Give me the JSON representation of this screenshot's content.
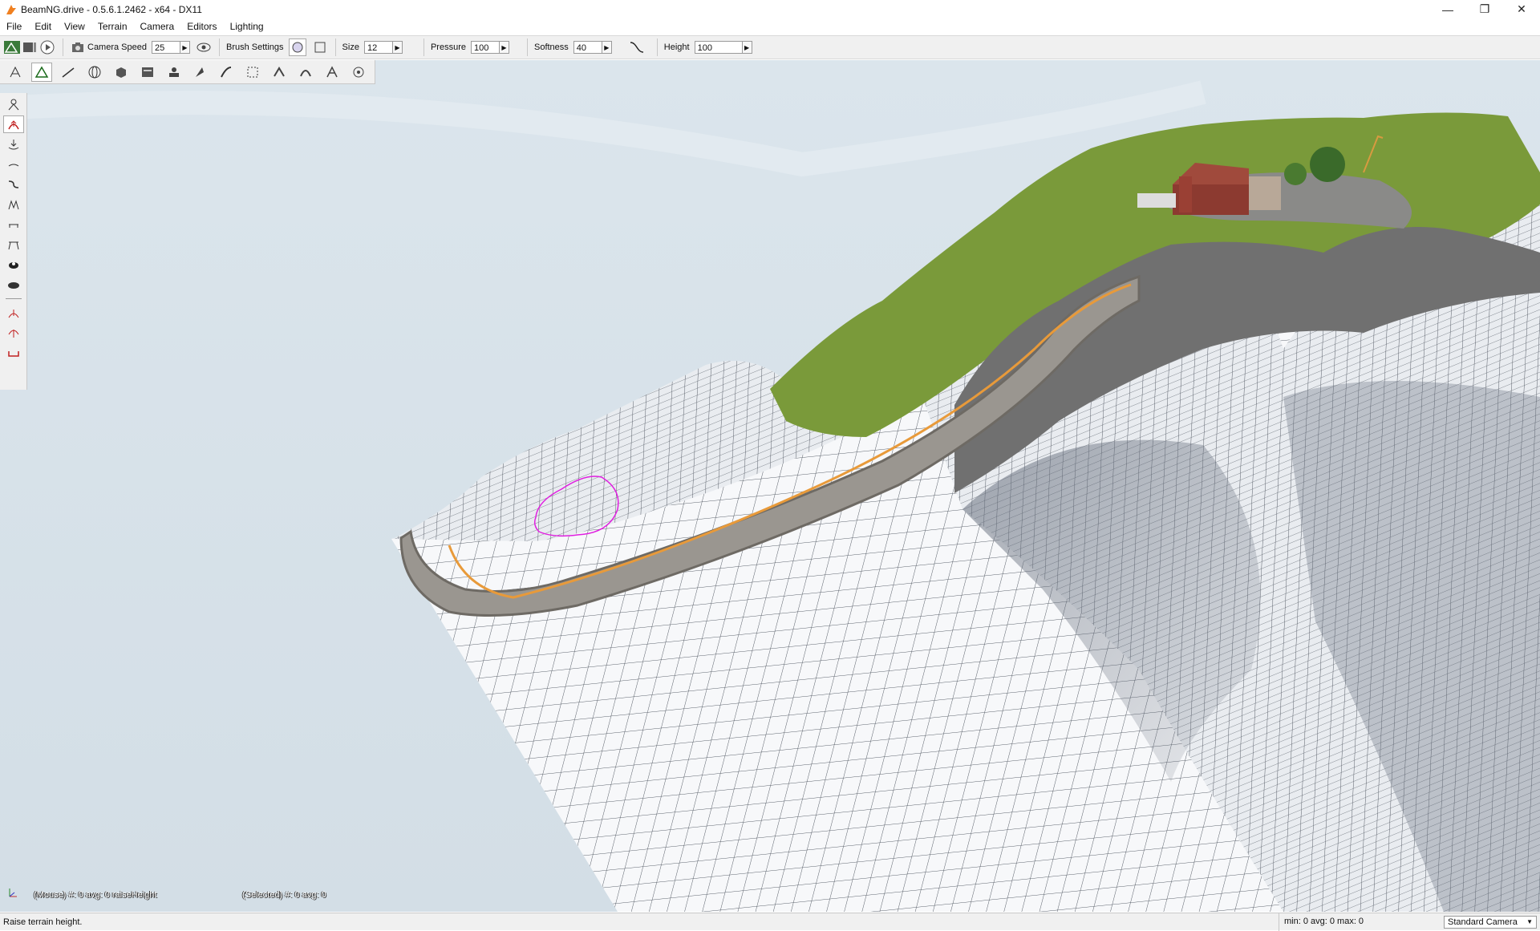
{
  "window": {
    "title": "BeamNG.drive - 0.5.6.1.2462 - x64 - DX11",
    "controls": [
      "minimize-icon",
      "restore-icon",
      "close-icon"
    ]
  },
  "menu": [
    "File",
    "Edit",
    "View",
    "Terrain",
    "Camera",
    "Editors",
    "Lighting"
  ],
  "toolbar": {
    "camera_speed_label": "Camera Speed",
    "camera_speed_value": "25",
    "brush_settings_label": "Brush Settings",
    "size_label": "Size",
    "size_value": "12",
    "pressure_label": "Pressure",
    "pressure_value": "100",
    "softness_label": "Softness",
    "softness_value": "40",
    "height_label": "Height",
    "height_value": "100"
  },
  "viewport": {
    "mouse_info": "(Mouse) #: 0  avg: 0 raiseHeight",
    "selected_info": "(Selected) #: 0  avg: 0"
  },
  "status": {
    "message": "Raise terrain height.",
    "stats": "min: 0  avg: 0  max: 0",
    "camera_mode": "Standard Camera"
  },
  "colors": {
    "brush_outline": "#e020e0",
    "road_line": "#e89a3a",
    "grass": "#7a9a3a",
    "rock": "#707070",
    "sky": "#d4e0e8"
  }
}
